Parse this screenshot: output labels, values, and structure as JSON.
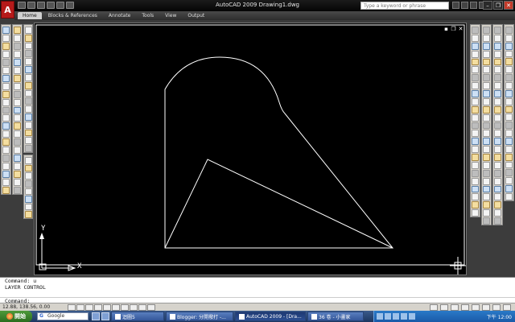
{
  "titlebar": {
    "title": "AutoCAD 2009  Drawing1.dwg",
    "search_placeholder": "Type a keyword or phrase",
    "logo": "A"
  },
  "ribbon": {
    "tabs": [
      {
        "label": "Home",
        "active": true
      },
      {
        "label": "Blocks & References",
        "active": false
      },
      {
        "label": "Annotate",
        "active": false
      },
      {
        "label": "Tools",
        "active": false
      },
      {
        "label": "View",
        "active": false
      },
      {
        "label": "Output",
        "active": false
      }
    ]
  },
  "canvas": {
    "ucs_y": "Y",
    "ucs_x": "X",
    "line_color": "#ffffff",
    "background": "#000000"
  },
  "command": {
    "line1": "Command: u",
    "line2": "LAYER CONTROL",
    "prompt": "Command:"
  },
  "status": {
    "coords": "12.88, 138.56, 0.00"
  },
  "taskbar": {
    "start": "開始",
    "google": "Google",
    "buttons": [
      {
        "label": "迴圖5",
        "active": false
      },
      {
        "label": "Blogger: 分開撥打 -...",
        "active": false
      },
      {
        "label": "AutoCAD 2009 - [Dra...",
        "active": true
      },
      {
        "label": "36 卷 - 小畫家",
        "active": false
      }
    ],
    "clock": "下午 12:00"
  },
  "icons": {
    "colors": {
      "accent": "#b51a1a",
      "taskbar": "#2c4e92"
    }
  }
}
